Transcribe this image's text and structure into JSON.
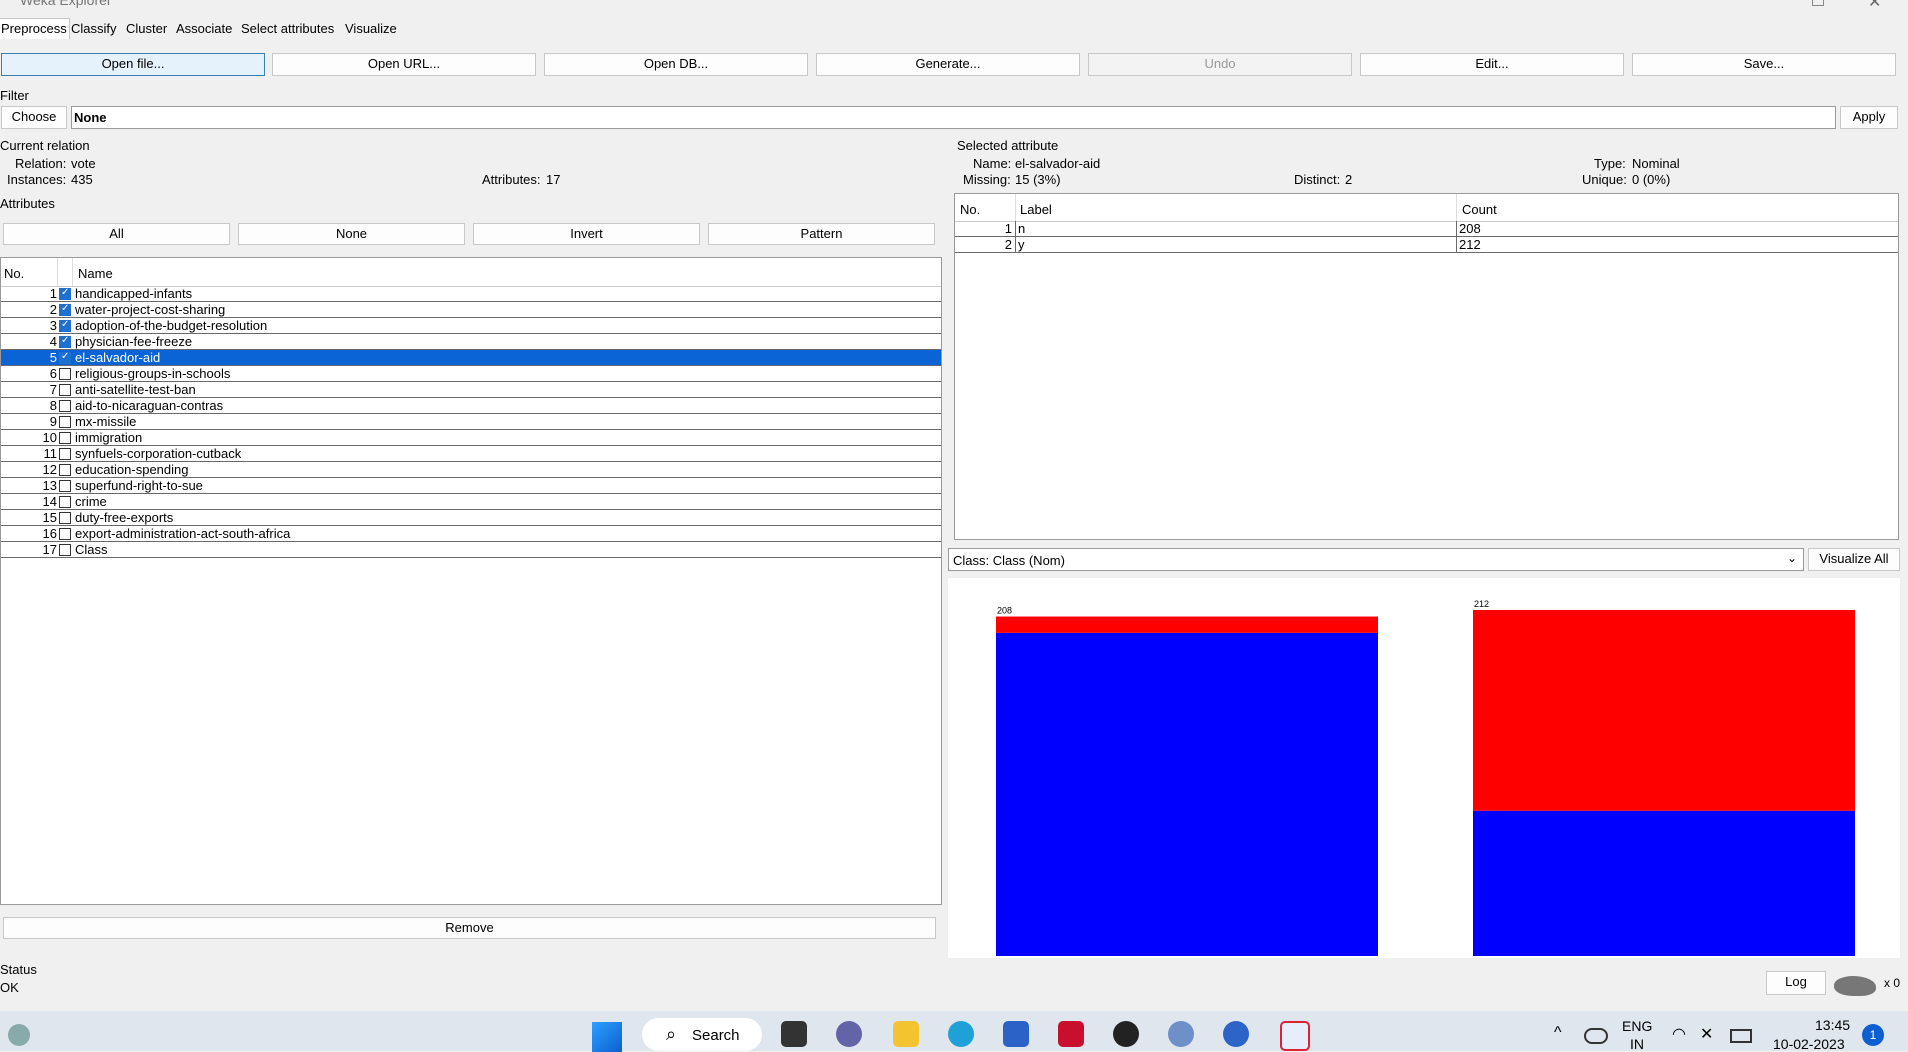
{
  "window": {
    "title": "Weka Explorer"
  },
  "tabs": [
    "Preprocess",
    "Classify",
    "Cluster",
    "Associate",
    "Select attributes",
    "Visualize"
  ],
  "toolbar": {
    "open_file": "Open file...",
    "open_url": "Open URL...",
    "open_db": "Open DB...",
    "generate": "Generate...",
    "undo": "Undo",
    "edit": "Edit...",
    "save": "Save..."
  },
  "filter": {
    "label": "Filter",
    "choose": "Choose",
    "value": "None",
    "apply": "Apply"
  },
  "current_relation": {
    "label": "Current relation",
    "relation_label": "Relation:",
    "relation": "vote",
    "instances_label": "Instances:",
    "instances": "435",
    "attributes_label": "Attributes:",
    "attributes": "17"
  },
  "attributes": {
    "label": "Attributes",
    "buttons": {
      "all": "All",
      "none": "None",
      "invert": "Invert",
      "pattern": "Pattern"
    },
    "col_no": "No.",
    "col_name": "Name",
    "remove": "Remove",
    "items": [
      {
        "no": "1",
        "name": "handicapped-infants",
        "checked": true
      },
      {
        "no": "2",
        "name": "water-project-cost-sharing",
        "checked": true
      },
      {
        "no": "3",
        "name": "adoption-of-the-budget-resolution",
        "checked": true
      },
      {
        "no": "4",
        "name": "physician-fee-freeze",
        "checked": true
      },
      {
        "no": "5",
        "name": "el-salvador-aid",
        "checked": true,
        "selected": true
      },
      {
        "no": "6",
        "name": "religious-groups-in-schools",
        "checked": false
      },
      {
        "no": "7",
        "name": "anti-satellite-test-ban",
        "checked": false
      },
      {
        "no": "8",
        "name": "aid-to-nicaraguan-contras",
        "checked": false
      },
      {
        "no": "9",
        "name": "mx-missile",
        "checked": false
      },
      {
        "no": "10",
        "name": "immigration",
        "checked": false
      },
      {
        "no": "11",
        "name": "synfuels-corporation-cutback",
        "checked": false
      },
      {
        "no": "12",
        "name": "education-spending",
        "checked": false
      },
      {
        "no": "13",
        "name": "superfund-right-to-sue",
        "checked": false
      },
      {
        "no": "14",
        "name": "crime",
        "checked": false
      },
      {
        "no": "15",
        "name": "duty-free-exports",
        "checked": false
      },
      {
        "no": "16",
        "name": "export-administration-act-south-africa",
        "checked": false
      },
      {
        "no": "17",
        "name": "Class",
        "checked": false
      }
    ]
  },
  "selected_attribute": {
    "label": "Selected attribute",
    "name_label": "Name:",
    "name": "el-salvador-aid",
    "type_label": "Type:",
    "type": "Nominal",
    "missing_label": "Missing:",
    "missing": "15 (3%)",
    "distinct_label": "Distinct:",
    "distinct": "2",
    "unique_label": "Unique:",
    "unique": "0 (0%)",
    "col_no": "No.",
    "col_label": "Label",
    "col_count": "Count",
    "rows": [
      {
        "no": "1",
        "label": "n",
        "count": "208"
      },
      {
        "no": "2",
        "label": "y",
        "count": "212"
      }
    ]
  },
  "class_select": {
    "value": "Class: Class (Nom)",
    "visualize_all": "Visualize All"
  },
  "chart_data": {
    "type": "bar",
    "categories": [
      "n",
      "y"
    ],
    "totals": [
      208,
      212
    ],
    "series": [
      {
        "color": "#0000ff",
        "values": [
          198,
          89
        ]
      },
      {
        "color": "#ff0000",
        "values": [
          10,
          123
        ]
      }
    ],
    "data_labels": [
      "208",
      "212"
    ]
  },
  "status": {
    "label": "Status",
    "text": "OK",
    "log": "Log",
    "x_count": "x 0"
  },
  "taskbar": {
    "search": "Search",
    "lang1": "ENG",
    "lang2": "IN",
    "time": "13:45",
    "date": "10-02-2023",
    "notif": "1"
  }
}
